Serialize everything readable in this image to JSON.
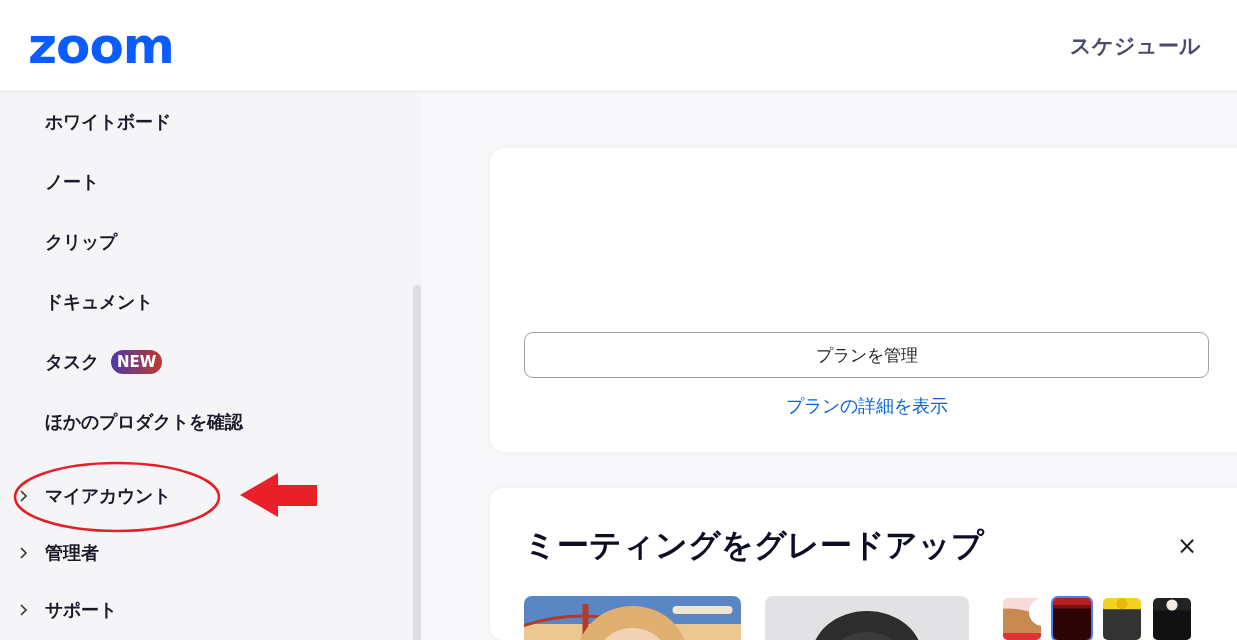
{
  "header": {
    "logo": "zoom",
    "nav_link": "スケジュール"
  },
  "sidebar": {
    "items": [
      {
        "kind": "link",
        "label": "ホワイトボード"
      },
      {
        "kind": "link",
        "label": "ノート"
      },
      {
        "kind": "link",
        "label": "クリップ"
      },
      {
        "kind": "link",
        "label": "ドキュメント"
      },
      {
        "kind": "link",
        "label": "タスク",
        "badge": "NEW"
      },
      {
        "kind": "link",
        "label": "ほかのプロダクトを確認"
      },
      {
        "kind": "group",
        "label": "マイアカウント",
        "expanded": false,
        "highlighted": true
      },
      {
        "kind": "group",
        "label": "管理者",
        "expanded": false,
        "highlighted": false
      },
      {
        "kind": "group",
        "label": "サポート",
        "expanded": false,
        "highlighted": false
      }
    ]
  },
  "plan_card": {
    "button": "プランを管理",
    "link": "プランの詳細を表示"
  },
  "upgrade_card": {
    "title": "ミーティングをグレードアップ",
    "close": "×",
    "pictures": [
      {
        "kind": "picture"
      },
      {
        "kind": "picture"
      },
      {
        "kind": "picture",
        "selected": false
      },
      {
        "kind": "picture",
        "selected": true
      },
      {
        "kind": "picture",
        "selected": false
      },
      {
        "kind": "picture",
        "selected": false
      }
    ]
  }
}
